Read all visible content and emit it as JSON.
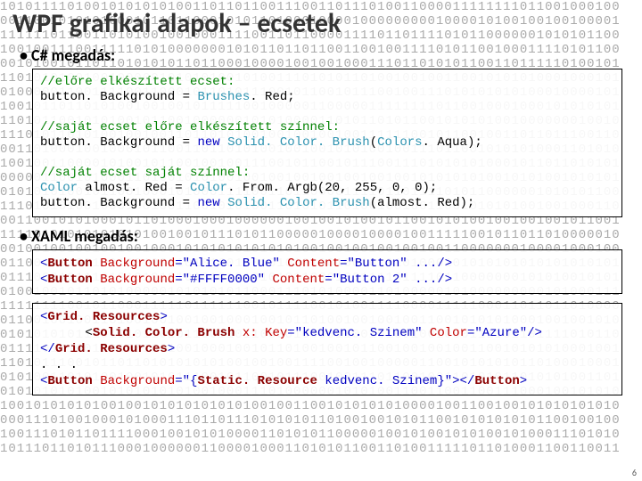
{
  "title": "WPF grafikai alapok – ecsetek",
  "sections": {
    "csharp_label": "C# megadás:",
    "xaml_label": "XAML megadás:"
  },
  "page_number": "6",
  "code1": {
    "c1": "//előre elkészített ecset:",
    "l2a": "button. Background = ",
    "l2b": "Brushes",
    "l2c": ". Red;",
    "c2": "//saját ecset előre elkészített színnel:",
    "l4a": "button. Background = ",
    "l4b": "new",
    "l4c": " ",
    "l4d": "Solid. Color. Brush",
    "l4e": "(",
    "l4f": "Colors",
    "l4g": ". Aqua);",
    "c3": "//saját ecset saját színnel:",
    "l6a": "Color",
    "l6b": " almost. Red = ",
    "l6c": "Color",
    "l6d": ". From. Argb(20, 255, 0, 0);",
    "l7a": "button. Background = ",
    "l7b": "new",
    "l7c": " ",
    "l7d": "Solid. Color. Brush",
    "l7e": "(almost. Red);"
  },
  "code2": {
    "l1a": "<",
    "l1b": "Button",
    "l1c": " ",
    "l1d": "Background",
    "l1e": "=\"Alice. Blue\"",
    "l1f": " ",
    "l1g": "Content",
    "l1h": "=\"Button\"",
    "l1i": " .../>",
    "l2a": "<",
    "l2b": "Button",
    "l2c": " ",
    "l2d": "Background",
    "l2e": "=\"#FFFF0000\"",
    "l2f": " ",
    "l2g": "Content",
    "l2h": "=\"Button 2\"",
    "l2i": " .../>"
  },
  "code3": {
    "l1a": "<",
    "l1b": "Grid. Resources",
    "l1c": ">",
    "l2a": "      <",
    "l2b": "Solid. Color. Brush",
    "l2c": " ",
    "l2d": "x: Key",
    "l2e": "=\"kedvenc. Szinem\"",
    "l2f": " ",
    "l2g": "Color",
    "l2h": "=\"Azure\"",
    "l2i": "/>",
    "l3a": "</",
    "l3b": "Grid. Resources",
    "l3c": ">",
    "l4": ". . .",
    "l5a": "<",
    "l5b": "Button",
    "l5c": " ",
    "l5d": "Background",
    "l5e": "=\"{",
    "l5f": "Static. Resource",
    "l5g": " kedvenc. Szinem",
    "l5h": "}\"",
    "l5i": "></",
    "l5j": "Button",
    "l5k": ">"
  },
  "bg_pattern": "10101111010010101010100110110110011100110111010011000011111111011001000100\n00110010101010001011011000101011010001000010000000001000010100100100100001\n11111101100110101001001000111100110110000111101101111010110000001010101100\n10010011100111110101000000010101101101100110010011110101100100011110101100\n00101001011011010101011011000100001001001000111011010101100110111110100101\n11010101001001000001010101001010011101010110100100100110010101010001000101\n01000001100111100110001011010111001011001011100100111010101010100010000101\n10010110110101001001001011111001000001100000111111110110010001000101010101\n11010110010101001011001000000101010000110101101011001010101001000000010010\n11101011010100100100110110101001001001001001111110010110010011011011100110\n00110100010010001011001101101010010010010101001001110110010101010001101010\n10010011000010100101100100100111001011001011100111010101010001011011010101\n00000110010100011010010101001001001001001001001001010101010010101001010101\n01010101001011001000101000111100110110000111101101111010110000001010101100\n11101010100100010010011001010100110101011010010010011001010101001001000110\n00110010101000101101000100010000001001001010010110010101001001001001011001\n11110101010101010100100101110101100000100001000010011111001011011010000010\n00100100100100100100010101010101010100100100100100100110000000100001000100\n01100100100100100100010101001001010101001001010101000101010101010101010101\n01110001011101010101010101010101010110001001111011110110000000101010010101\n01001001011010100000101010101100011101010000110100000101000000000101000111\n11111111001011000111110111111001011110010100111100001111100011011011010000\n01100100100110100100100100100010010110100100100100110010101010001001001010\n01010101011101010110101100110110000100001100101001001000111101101111010110\n01111010100110100100100100010010110100100101100100100100110010101010001001\n11010111001011011010101010100100100111100100100000110010101010110100010001\n01010011010100100101011100101100101110010011101100100110101011010101001101\n01010101010010101010101001000111010000001010100110011001100111000100101010\n10010101010100100101010101010100100110010101010100001001100100101010101010\n00011101001000101000111011011101010101101001001010110010101010101100100100\n10011101011011110001001010100001101010110000010010100101010010100011101010\n10111011010111000100000011000010001101010110011010011111011010001100110011"
}
